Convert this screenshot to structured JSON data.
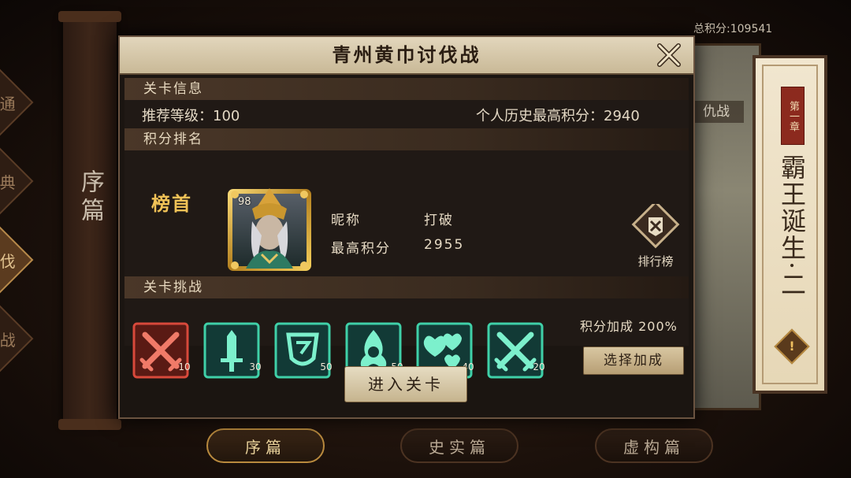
{
  "background": {
    "total_score": "总积分:109541",
    "left_scroll_title": "序篇",
    "left_side_tabs": [
      "普通",
      "经典",
      "讨伐",
      "挑战"
    ],
    "right_label": "仇战",
    "chapter": {
      "tag": "第一章",
      "name": "霸王诞生·二",
      "alert": "!"
    },
    "bottom_tabs": [
      {
        "label": "序篇",
        "active": true
      },
      {
        "label": "史实篇",
        "active": false
      },
      {
        "label": "虚构篇",
        "active": false
      }
    ]
  },
  "modal": {
    "title": "青州黄巾讨伐战",
    "sections": {
      "stage_info": "关卡信息",
      "score_rank": "积分排名",
      "stage_challenge": "关卡挑战"
    },
    "stage_info": {
      "recommended_level": "推荐等级：100",
      "personal_best": "个人历史最高积分：2940"
    },
    "ranking": {
      "rank_title": "榜首",
      "portrait_level": "98",
      "nickname_label": "昵称",
      "nickname_value": "打破",
      "best_score_label": "最高积分",
      "best_score_value": "2955",
      "leaderboard_label": "排行榜"
    },
    "challenges": [
      {
        "icon": "crossed-swords-icon",
        "count": "10",
        "color": "#d8493b"
      },
      {
        "icon": "sword-icon",
        "count": "30",
        "color": "#3fd0a8"
      },
      {
        "icon": "shield-icon",
        "count": "50",
        "color": "#3fd0a8"
      },
      {
        "icon": "flame-figure-icon",
        "count": "50",
        "color": "#3fd0a8"
      },
      {
        "icon": "hearts-icon",
        "count": "40",
        "color": "#3fd0a8"
      },
      {
        "icon": "crossed-swords-icon",
        "count": "20",
        "color": "#3fd0a8"
      }
    ],
    "bonus_text": "积分加成 200%",
    "select_bonus_label": "选择加成",
    "enter_label": "进入关卡"
  }
}
